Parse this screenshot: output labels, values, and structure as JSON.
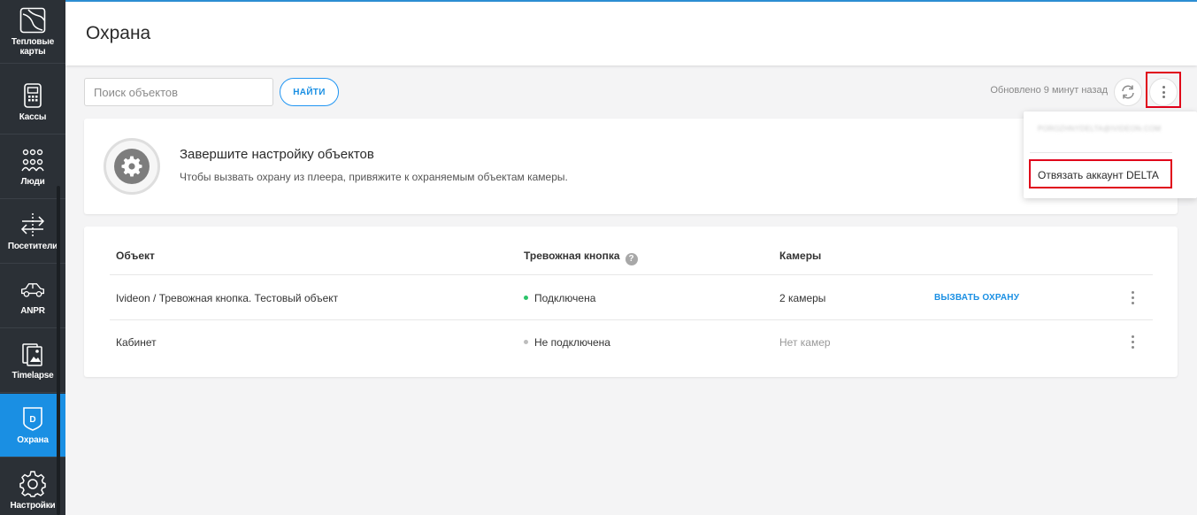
{
  "sidebar": {
    "items": [
      {
        "label": "Тепловые\nкарты",
        "icon": "heatmap-icon"
      },
      {
        "label": "Кассы",
        "icon": "cash-register-icon"
      },
      {
        "label": "Люди",
        "icon": "people-icon"
      },
      {
        "label": "Посетители",
        "icon": "visitors-arrows-icon"
      },
      {
        "label": "ANPR",
        "icon": "car-icon"
      },
      {
        "label": "Timelapse",
        "icon": "timelapse-icon"
      },
      {
        "label": "Охрана",
        "icon": "shield-d-icon",
        "active": true
      },
      {
        "label": "Настройки",
        "icon": "gear-icon"
      }
    ]
  },
  "header": {
    "title": "Охрана"
  },
  "toolbar": {
    "search_placeholder": "Поиск объектов",
    "search_value": "",
    "find_label": "НАЙТИ",
    "updated_text": "Обновлено 9 минут назад"
  },
  "setup": {
    "title": "Завершите настройку объектов",
    "description": "Чтобы вызвать охрану из плеера, привяжите к охраняемым объектам камеры."
  },
  "table": {
    "headers": {
      "object": "Объект",
      "alarm": "Тревожная кнопка",
      "cameras": "Камеры"
    },
    "help_glyph": "?",
    "rows": [
      {
        "object": "Ivideon / Тревожная кнопка. Тестовый объект",
        "status": "Подключена",
        "status_color": "#2bc46a",
        "cameras": "2 камеры",
        "action": "ВЫЗВАТЬ ОХРАНУ"
      },
      {
        "object": "Кабинет",
        "status": "Не подключена",
        "status_color": "#bdbdbd",
        "cameras": "Нет камер",
        "action": ""
      }
    ]
  },
  "dropdown": {
    "email": "POROZHNYDELTA@IVIDEON.COM",
    "unlink_label": "Отвязать аккаунт DELTA"
  },
  "colors": {
    "accent": "#1a8fe3",
    "sidebar_bg": "#2b3036",
    "highlight": "#e0001a"
  }
}
